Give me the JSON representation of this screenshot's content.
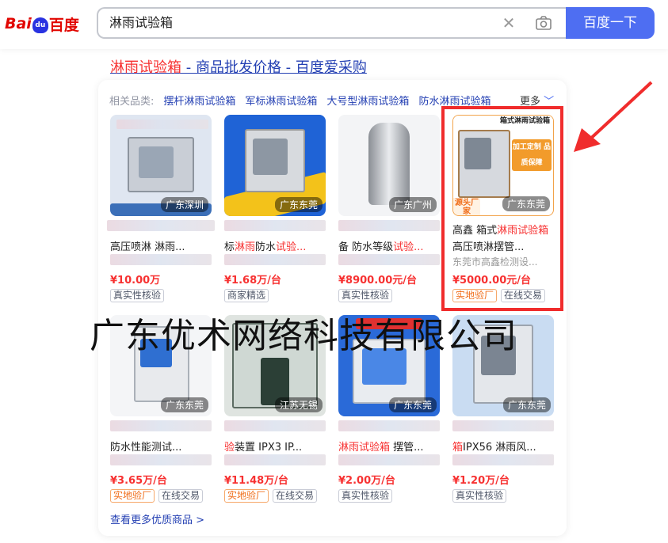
{
  "header": {
    "logo": {
      "bai": "Bai",
      "du": "du",
      "cn": "百度"
    },
    "search_value": "淋雨试验箱",
    "search_button": "百度一下"
  },
  "result_title": {
    "hl": "淋雨试验箱",
    "rest": " - 商品批发价格 - 百度爱采购"
  },
  "related": {
    "label": "相关品类:",
    "items": [
      "摆杆淋雨试验箱",
      "军标淋雨试验箱",
      "大号型淋雨试验箱",
      "防水淋雨试验箱"
    ],
    "more": "更多"
  },
  "products": [
    {
      "location": "广东深圳",
      "title1": "高压喷淋 淋雨...",
      "title1_hl": "",
      "title2": "",
      "price": "¥10.00万",
      "tags": [
        {
          "text": "真实性核验",
          "style": "gray"
        }
      ]
    },
    {
      "location": "广东东莞",
      "title1_pre": "标",
      "title1_hl": "淋雨",
      "title1_post": "防水",
      "title1_hl2": "试验...",
      "price": "¥1.68万/台",
      "tags": [
        {
          "text": "商家精选",
          "style": "gray"
        }
      ]
    },
    {
      "location": "广东广州",
      "title1_pre": "备 防水等级",
      "title1_hl": "试验...",
      "price": "¥8900.00元/台",
      "tags": [
        {
          "text": "真实性核验",
          "style": "gray"
        }
      ]
    },
    {
      "location": "广东东莞",
      "badge": "源头厂家",
      "img_title": "箱式淋雨试验箱",
      "img_banner": "加工定制 品质保障",
      "title1_pre": "高鑫 箱式",
      "title1_hl": "淋雨试验箱",
      "title2": "高压喷淋摆管...",
      "title3": "东莞市高鑫检测设...",
      "price": "¥5000.00元/台",
      "tags": [
        {
          "text": "实地验厂",
          "style": "orange"
        },
        {
          "text": "在线交易",
          "style": "gray"
        }
      ]
    },
    {
      "location": "广东东莞",
      "title1": "防水性能测试...",
      "price": "¥3.65万/台",
      "tags": [
        {
          "text": "实地验厂",
          "style": "orange"
        },
        {
          "text": "在线交易",
          "style": "gray"
        }
      ]
    },
    {
      "location": "江苏无锡",
      "title1_pre": "",
      "title1_hl": "验",
      "title1_post": "装置 IPX3 IP...",
      "price": "¥11.48万/台",
      "tags": [
        {
          "text": "实地验厂",
          "style": "orange"
        },
        {
          "text": "在线交易",
          "style": "gray"
        }
      ]
    },
    {
      "location": "广东东莞",
      "title1_hl": "淋雨试验箱",
      "title1_post": " 摆管...",
      "price": "¥2.00万/台",
      "tags": [
        {
          "text": "真实性核验",
          "style": "gray"
        }
      ]
    },
    {
      "location": "广东东莞",
      "title1_hl": "箱",
      "title1_post": "IPX56 淋雨风...",
      "price": "¥1.20万/台",
      "tags": [
        {
          "text": "真实性核验",
          "style": "gray"
        }
      ]
    }
  ],
  "see_more": "查看更多优质商品 >",
  "watermark": "广东优术网络科技有限公司",
  "colors": {
    "accent": "#4e6ef2",
    "highlight": "#f73131",
    "link": "#2440b3",
    "redbox": "#f02c2c"
  }
}
